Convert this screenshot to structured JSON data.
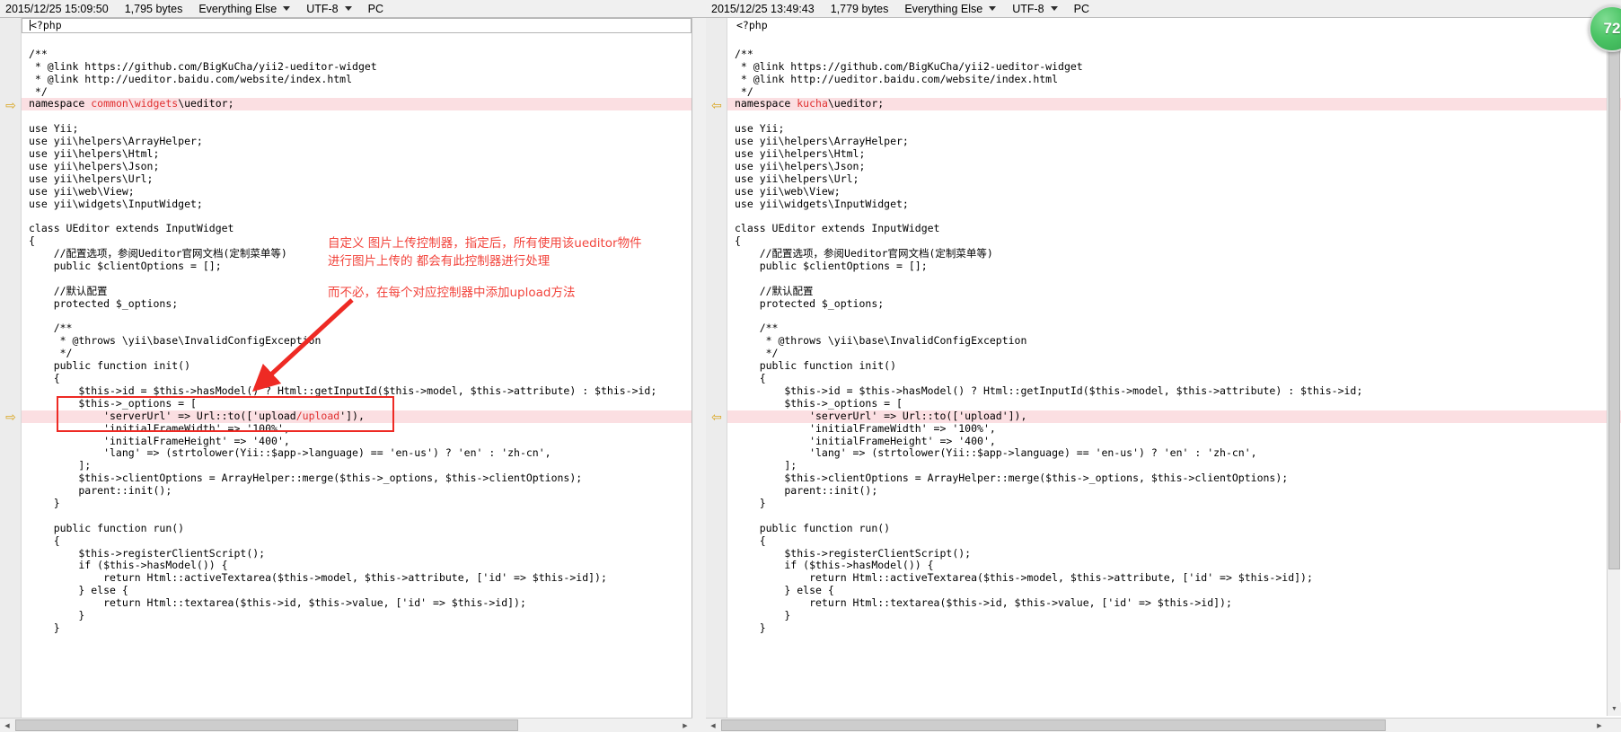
{
  "left_header": {
    "timestamp": "2015/12/25 15:09:50",
    "size": "1,795 bytes",
    "filetype": "Everything Else",
    "encoding": "UTF-8",
    "platform": "PC"
  },
  "right_header": {
    "timestamp": "2015/12/25 13:49:43",
    "size": "1,779 bytes",
    "filetype": "Everything Else",
    "encoding": "UTF-8",
    "platform": "PC"
  },
  "left_first_line": "<?php",
  "right_first_line": "<?php",
  "left_code": [
    {
      "text": "",
      "diff": false
    },
    {
      "text": "/**",
      "diff": false
    },
    {
      "text": " * @link https://github.com/BigKuCha/yii2-ueditor-widget",
      "diff": false
    },
    {
      "text": " * @link http://ueditor.baidu.com/website/index.html",
      "diff": false
    },
    {
      "text": " */",
      "diff": false
    },
    {
      "text": "namespace common\\widgets\\ueditor;",
      "diff": true,
      "pre": "namespace ",
      "hl": "common\\widgets",
      "post": "\\ueditor;"
    },
    {
      "text": "",
      "diff": false
    },
    {
      "text": "use Yii;",
      "diff": false
    },
    {
      "text": "use yii\\helpers\\ArrayHelper;",
      "diff": false
    },
    {
      "text": "use yii\\helpers\\Html;",
      "diff": false
    },
    {
      "text": "use yii\\helpers\\Json;",
      "diff": false
    },
    {
      "text": "use yii\\helpers\\Url;",
      "diff": false
    },
    {
      "text": "use yii\\web\\View;",
      "diff": false
    },
    {
      "text": "use yii\\widgets\\InputWidget;",
      "diff": false
    },
    {
      "text": "",
      "diff": false
    },
    {
      "text": "class UEditor extends InputWidget",
      "diff": false
    },
    {
      "text": "{",
      "diff": false
    },
    {
      "text": "    //配置选项，参阅Ueditor官网文档(定制菜单等)",
      "diff": false
    },
    {
      "text": "    public $clientOptions = [];",
      "diff": false
    },
    {
      "text": "",
      "diff": false
    },
    {
      "text": "    //默认配置",
      "diff": false
    },
    {
      "text": "    protected $_options;",
      "diff": false
    },
    {
      "text": "",
      "diff": false
    },
    {
      "text": "    /**",
      "diff": false
    },
    {
      "text": "     * @throws \\yii\\base\\InvalidConfigException",
      "diff": false
    },
    {
      "text": "     */",
      "diff": false
    },
    {
      "text": "    public function init()",
      "diff": false
    },
    {
      "text": "    {",
      "diff": false
    },
    {
      "text": "        $this->id = $this->hasModel() ? Html::getInputId($this->model, $this->attribute) : $this->id;",
      "diff": false
    },
    {
      "text": "        $this->_options = [",
      "diff": false
    },
    {
      "text": "            'serverUrl' => Url::to(['upload/upload']),",
      "diff": true,
      "pre": "            'serverUrl' => Url::to(['upload",
      "hl": "/upload",
      "post": "']),"
    },
    {
      "text": "            'initialFrameWidth' => '100%',",
      "diff": false
    },
    {
      "text": "            'initialFrameHeight' => '400',",
      "diff": false
    },
    {
      "text": "            'lang' => (strtolower(Yii::$app->language) == 'en-us') ? 'en' : 'zh-cn',",
      "diff": false
    },
    {
      "text": "        ];",
      "diff": false
    },
    {
      "text": "        $this->clientOptions = ArrayHelper::merge($this->_options, $this->clientOptions);",
      "diff": false
    },
    {
      "text": "        parent::init();",
      "diff": false
    },
    {
      "text": "    }",
      "diff": false
    },
    {
      "text": "",
      "diff": false
    },
    {
      "text": "    public function run()",
      "diff": false
    },
    {
      "text": "    {",
      "diff": false
    },
    {
      "text": "        $this->registerClientScript();",
      "diff": false
    },
    {
      "text": "        if ($this->hasModel()) {",
      "diff": false
    },
    {
      "text": "            return Html::activeTextarea($this->model, $this->attribute, ['id' => $this->id]);",
      "diff": false
    },
    {
      "text": "        } else {",
      "diff": false
    },
    {
      "text": "            return Html::textarea($this->id, $this->value, ['id' => $this->id]);",
      "diff": false
    },
    {
      "text": "        }",
      "diff": false
    },
    {
      "text": "    }",
      "diff": false
    }
  ],
  "right_code": [
    {
      "text": "",
      "diff": false
    },
    {
      "text": "/**",
      "diff": false
    },
    {
      "text": " * @link https://github.com/BigKuCha/yii2-ueditor-widget",
      "diff": false
    },
    {
      "text": " * @link http://ueditor.baidu.com/website/index.html",
      "diff": false
    },
    {
      "text": " */",
      "diff": false
    },
    {
      "text": "namespace kucha\\ueditor;",
      "diff": true,
      "pre": "namespace ",
      "hl": "kucha",
      "post": "\\ueditor;"
    },
    {
      "text": "",
      "diff": false
    },
    {
      "text": "use Yii;",
      "diff": false
    },
    {
      "text": "use yii\\helpers\\ArrayHelper;",
      "diff": false
    },
    {
      "text": "use yii\\helpers\\Html;",
      "diff": false
    },
    {
      "text": "use yii\\helpers\\Json;",
      "diff": false
    },
    {
      "text": "use yii\\helpers\\Url;",
      "diff": false
    },
    {
      "text": "use yii\\web\\View;",
      "diff": false
    },
    {
      "text": "use yii\\widgets\\InputWidget;",
      "diff": false
    },
    {
      "text": "",
      "diff": false
    },
    {
      "text": "class UEditor extends InputWidget",
      "diff": false
    },
    {
      "text": "{",
      "diff": false
    },
    {
      "text": "    //配置选项，参阅Ueditor官网文档(定制菜单等)",
      "diff": false
    },
    {
      "text": "    public $clientOptions = [];",
      "diff": false
    },
    {
      "text": "",
      "diff": false
    },
    {
      "text": "    //默认配置",
      "diff": false
    },
    {
      "text": "    protected $_options;",
      "diff": false
    },
    {
      "text": "",
      "diff": false
    },
    {
      "text": "    /**",
      "diff": false
    },
    {
      "text": "     * @throws \\yii\\base\\InvalidConfigException",
      "diff": false
    },
    {
      "text": "     */",
      "diff": false
    },
    {
      "text": "    public function init()",
      "diff": false
    },
    {
      "text": "    {",
      "diff": false
    },
    {
      "text": "        $this->id = $this->hasModel() ? Html::getInputId($this->model, $this->attribute) : $this->id;",
      "diff": false
    },
    {
      "text": "        $this->_options = [",
      "diff": false
    },
    {
      "text": "            'serverUrl' => Url::to(['upload']),",
      "diff": true,
      "pre": "            'serverUrl' => Url::to(['upload']),",
      "hl": "",
      "post": ""
    },
    {
      "text": "            'initialFrameWidth' => '100%',",
      "diff": false
    },
    {
      "text": "            'initialFrameHeight' => '400',",
      "diff": false
    },
    {
      "text": "            'lang' => (strtolower(Yii::$app->language) == 'en-us') ? 'en' : 'zh-cn',",
      "diff": false
    },
    {
      "text": "        ];",
      "diff": false
    },
    {
      "text": "        $this->clientOptions = ArrayHelper::merge($this->_options, $this->clientOptions);",
      "diff": false
    },
    {
      "text": "        parent::init();",
      "diff": false
    },
    {
      "text": "    }",
      "diff": false
    },
    {
      "text": "",
      "diff": false
    },
    {
      "text": "    public function run()",
      "diff": false
    },
    {
      "text": "    {",
      "diff": false
    },
    {
      "text": "        $this->registerClientScript();",
      "diff": false
    },
    {
      "text": "        if ($this->hasModel()) {",
      "diff": false
    },
    {
      "text": "            return Html::activeTextarea($this->model, $this->attribute, ['id' => $this->id]);",
      "diff": false
    },
    {
      "text": "        } else {",
      "diff": false
    },
    {
      "text": "            return Html::textarea($this->id, $this->value, ['id' => $this->id]);",
      "diff": false
    },
    {
      "text": "        }",
      "diff": false
    },
    {
      "text": "    }",
      "diff": false
    }
  ],
  "annotation": {
    "line1": "自定义 图片上传控制器，指定后，所有使用该ueditor物件",
    "line2": "进行图片上传的 都会有此控制器进行处理",
    "line3": "而不必，在每个对应控制器中添加upload方法",
    "color": "#f2453d"
  },
  "badge": {
    "label": "72",
    "color": "#4cc566"
  },
  "icons": {
    "caret_down": "▼",
    "gutter_arrow_right": "⇨",
    "gutter_arrow_left": "⇦",
    "scroll_up": "▲",
    "scroll_down": "▼",
    "scroll_left": "◀",
    "scroll_right": "▶"
  }
}
